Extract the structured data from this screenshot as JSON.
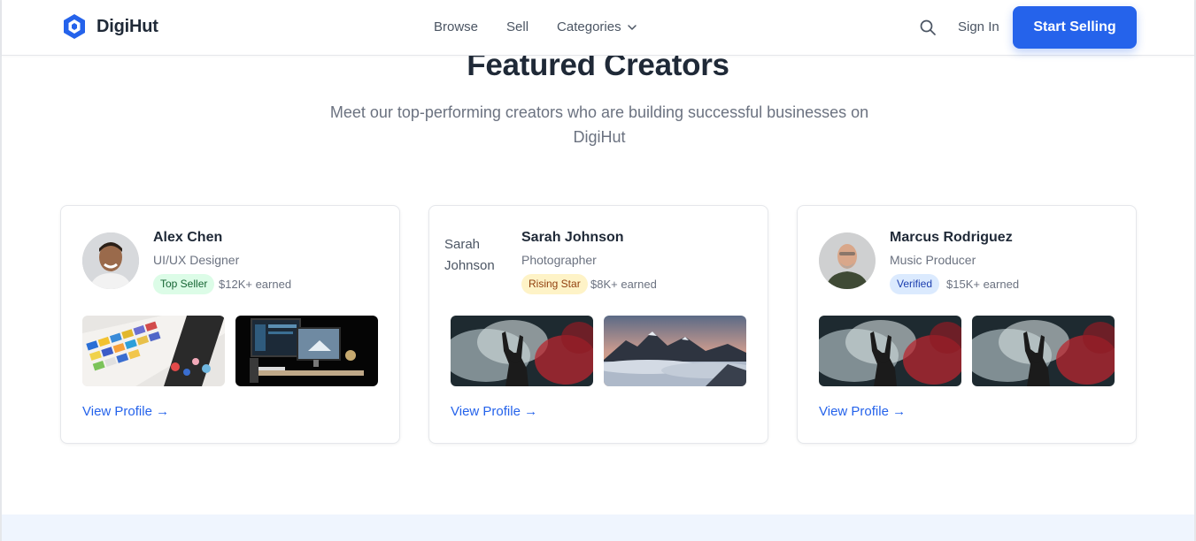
{
  "brand": {
    "name": "DigiHut",
    "accent": "#2563eb"
  },
  "nav": {
    "links": [
      "Browse",
      "Sell",
      "Categories"
    ],
    "sign_in": "Sign In",
    "cta": "Start Selling"
  },
  "section": {
    "title": "Featured Creators",
    "subtitle": "Meet our top-performing creators who are building successful businesses on DigiHut"
  },
  "creators": [
    {
      "name": "Alex Chen",
      "role": "UI/UX Designer",
      "badge": "Top Seller",
      "badge_color": "#dcfce7",
      "badge_text_color": "#166534",
      "earned": "$12K+ earned",
      "link": "View Profile →"
    },
    {
      "name": "Sarah Johnson",
      "avatar_alt": "Sarah Johnson",
      "role": "Photographer",
      "badge": "Rising Star",
      "badge_color": "#fef3c7",
      "badge_text_color": "#92400e",
      "earned": "$8K+ earned",
      "link": "View Profile →"
    },
    {
      "name": "Marcus Rodriguez",
      "role": "Music Producer",
      "badge": "Verified",
      "badge_color": "#dbeafe",
      "badge_text_color": "#1e40af",
      "earned": "$15K+ earned",
      "link": "View Profile →"
    }
  ]
}
